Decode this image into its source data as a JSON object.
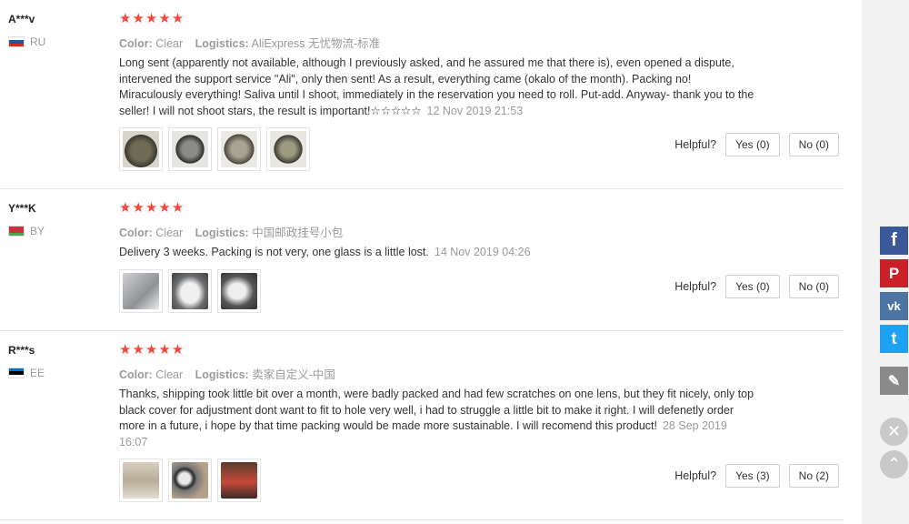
{
  "labels": {
    "color": "Color:",
    "logistics": "Logistics:",
    "helpful": "Helpful?"
  },
  "reviews": [
    {
      "user": "A***v",
      "country": "RU",
      "stars": "★★★★★",
      "color": "Clear",
      "logistics": "AliExpress 无忧物流-标准",
      "text": "Long sent (apparently not available, although I previously asked, and he assured me that there is), even opened a dispute, intervened the support service \"Ali\", only then sent! As a result, everything came (okalo of the month). Packing no! Miraculously everything! Saliva until I shoot, immediately in the reservation you need to roll. Put-add. Anyway- thank you to the seller! I will not shoot stars, the result is important!☆☆☆☆☆",
      "date": "12 Nov 2019 21:53",
      "yes": "Yes (0)",
      "no": "No (0)"
    },
    {
      "user": "Y***K",
      "country": "BY",
      "stars": "★★★★★",
      "color": "Clear",
      "logistics": "中国邮政挂号小包",
      "text": "Delivery 3 weeks. Packing is not very, one glass is a little lost.",
      "date": "14 Nov 2019 04:26",
      "yes": "Yes (0)",
      "no": "No (0)"
    },
    {
      "user": "R***s",
      "country": "EE",
      "stars": "★★★★★",
      "color": "Clear",
      "logistics": "卖家自定义-中国",
      "text": "Thanks, shipping took little bit over a month, were badly packed and had few scratches on one lens, but they fit nicely, only top black cover for adjustment dont want to fit to hole very well, i had to struggle a little bit to make it right. I will defenetly order more in a future, i hope by that time packing would be made more sustainable. I will recomend this product!",
      "date": "28 Sep 2019 16:07",
      "yes": "Yes (3)",
      "no": "No (2)"
    }
  ],
  "share": {
    "facebook": "f",
    "pinterest": "P",
    "vk": "vk",
    "twitter": "t",
    "edit": "✎",
    "close": "✕",
    "up": "⌃"
  }
}
